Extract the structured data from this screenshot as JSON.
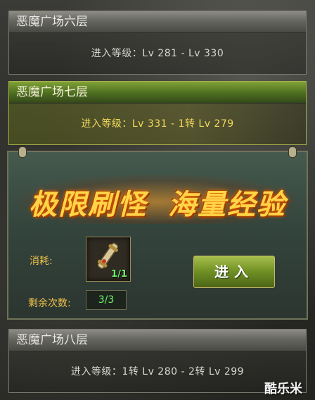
{
  "floors": [
    {
      "title": "恶魔广场六层",
      "requirement": "进入等级：Lv 281 - Lv 330"
    },
    {
      "title": "恶魔广场七层",
      "requirement": "进入等级：Lv 331 - 1转 Lv 279"
    },
    {
      "title": "恶魔广场八层",
      "requirement": "进入等级：1转 Lv 280 - 2转 Lv 299"
    }
  ],
  "panel": {
    "banner_left": "极限刷怪",
    "banner_right": "海量经验",
    "cost_label": "消耗:",
    "item_count": "1/1",
    "item_icon": "scroll-icon",
    "remain_label": "剩余次数:",
    "remain_value": "3/3",
    "enter_label": "进入"
  },
  "watermark": "酷乐米"
}
